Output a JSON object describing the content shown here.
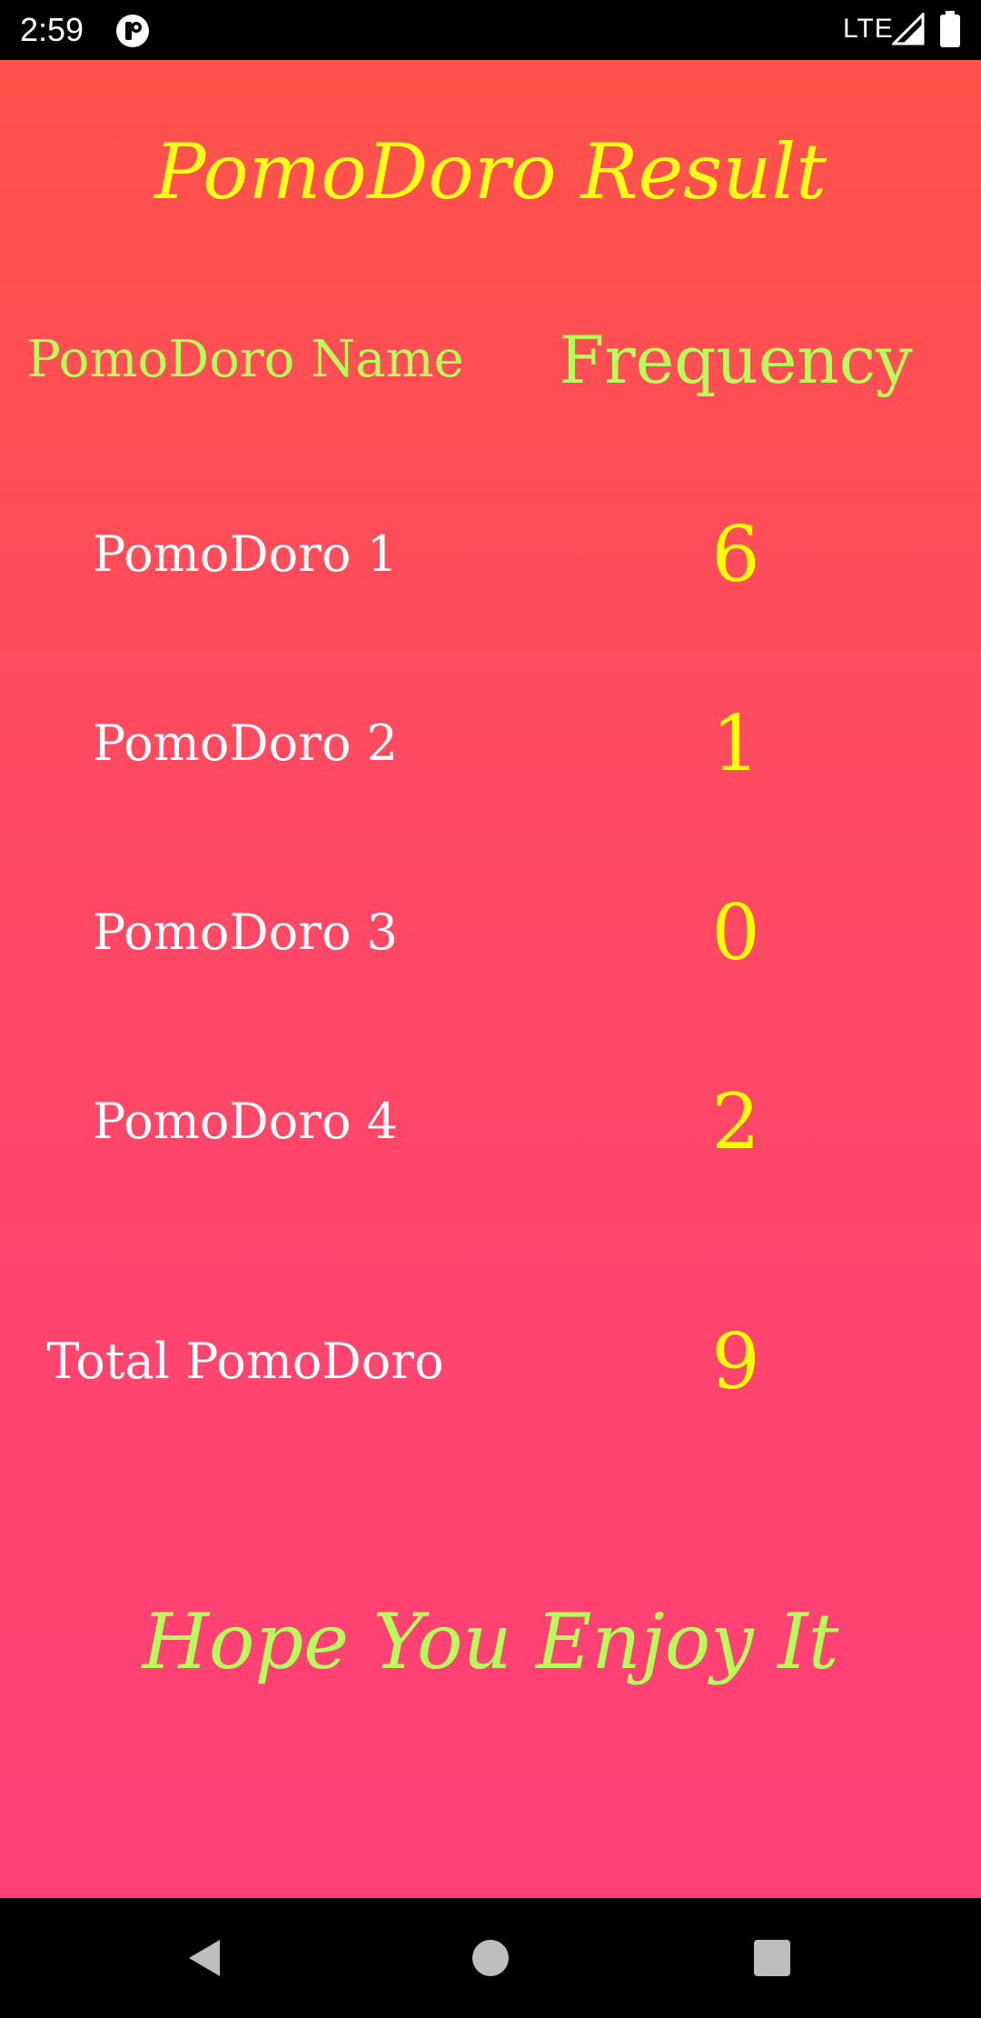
{
  "status_bar": {
    "time": "2:59",
    "network": "LTE",
    "icons": [
      "app-notification-icon",
      "signal-icon",
      "battery-icon"
    ]
  },
  "screen": {
    "title": "PomoDoro Result",
    "headers": {
      "name": "PomoDoro Name",
      "frequency": "Frequency"
    },
    "rows": [
      {
        "name": "PomoDoro 1",
        "value": "6"
      },
      {
        "name": "PomoDoro 2",
        "value": "1"
      },
      {
        "name": "PomoDoro 3",
        "value": "0"
      },
      {
        "name": "PomoDoro 4",
        "value": "2"
      }
    ],
    "total": {
      "name": "Total PomoDoro",
      "value": "9"
    },
    "footer": "Hope You Enjoy It"
  },
  "colors": {
    "title": "#ffff1a",
    "header": "#b6ff5a",
    "name_text": "#ffffff",
    "value_text": "#ffff00",
    "gradient_top": "#ff524a",
    "gradient_bottom": "#ff3f78"
  },
  "nav_bar": {
    "icons": [
      "back-icon",
      "home-icon",
      "recents-icon"
    ]
  }
}
